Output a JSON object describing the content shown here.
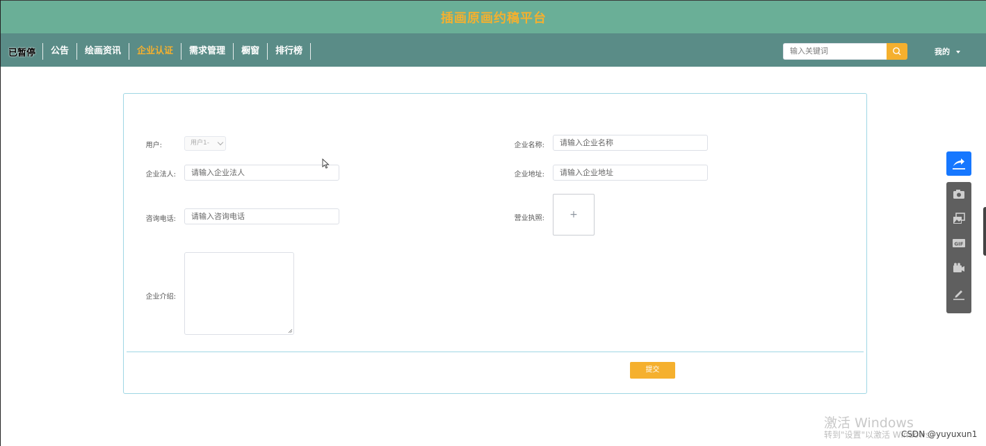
{
  "header": {
    "title": "插画原画约稿平台"
  },
  "nav": {
    "paused_label": "已暂停",
    "items": [
      "公告",
      "绘画资讯",
      "企业认证",
      "需求管理",
      "橱窗",
      "排行榜"
    ],
    "active": "企业认证"
  },
  "search": {
    "placeholder": "输入关键词"
  },
  "user_menu": {
    "label": "我的"
  },
  "form": {
    "user_label": "用户:",
    "user_value": "用户1-",
    "company_name_label": "企业名称:",
    "company_name_placeholder": "请输入企业名称",
    "legal_person_label": "企业法人:",
    "legal_person_placeholder": "请输入企业法人",
    "address_label": "企业地址:",
    "address_placeholder": "请输入企业地址",
    "phone_label": "咨询电话:",
    "phone_placeholder": "请输入咨询电话",
    "license_label": "营业执照:",
    "upload_plus": "+",
    "intro_label": "企业介绍:",
    "submit_label": "提交"
  },
  "overlay": {
    "windows_activate_title": "激活 Windows",
    "windows_activate_sub": "转到\"设置\"以激活 Windows。",
    "csdn_watermark": "CSDN @yuyuxun1"
  },
  "colors": {
    "titlebar": "#6aaf97",
    "nav": "#5a8c87",
    "accent": "#f5b02e",
    "card_border": "#9ed6e4",
    "tool_primary": "#1677ff"
  },
  "icons": [
    "search-icon",
    "caret-down-icon",
    "share-icon",
    "camera-icon",
    "images-icon",
    "gif-icon",
    "video-icon",
    "pen-icon",
    "mouse-cursor-icon",
    "resize-grip-icon"
  ]
}
